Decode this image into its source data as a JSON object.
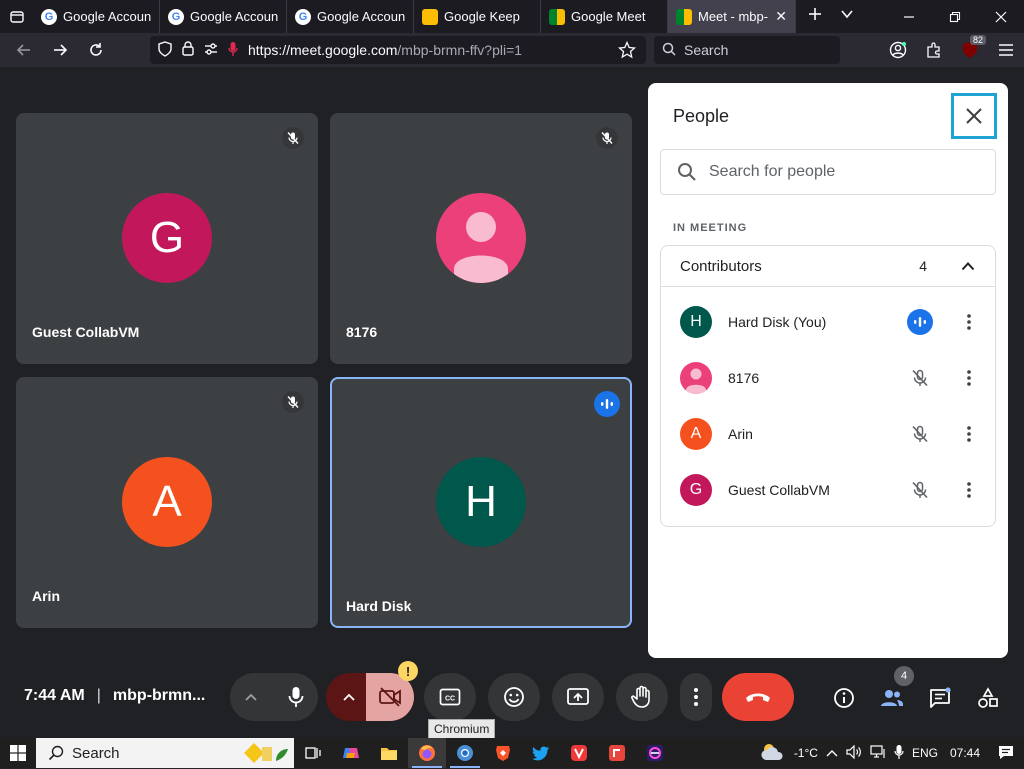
{
  "browser": {
    "tabs": [
      {
        "title": "Google Account",
        "favicon": "google-icon"
      },
      {
        "title": "Google Account",
        "favicon": "google-icon"
      },
      {
        "title": "Google Account",
        "favicon": "google-icon"
      },
      {
        "title": "Google Keep",
        "favicon": "keep-icon"
      },
      {
        "title": "Google Meet",
        "favicon": "meet-icon"
      },
      {
        "title": "Meet - mbp-b",
        "favicon": "meet-icon",
        "active": true
      }
    ],
    "url_host": "https://meet.google.com",
    "url_path": "/mbp-brmn-ffv?pli=1",
    "search_placeholder": "Search",
    "extension_badge": "82"
  },
  "tiles": [
    {
      "name": "Guest CollabVM",
      "initial": "G",
      "color": "#c2185b",
      "muted": true
    },
    {
      "name": "8176",
      "initial": "",
      "color": "#ec407a",
      "muted": true
    },
    {
      "name": "Arin",
      "initial": "A",
      "color": "#f4511e",
      "muted": true
    },
    {
      "name": "Hard Disk",
      "initial": "H",
      "color": "#00574b",
      "speaking": true
    }
  ],
  "people_panel": {
    "title": "People",
    "search_placeholder": "Search for people",
    "section_label": "IN MEETING",
    "group_label": "Contributors",
    "group_count": "4",
    "people": [
      {
        "name": "Hard Disk (You)",
        "initial": "H",
        "color": "#00574b",
        "speaking": true
      },
      {
        "name": "8176",
        "initial": "",
        "color": "#ec407a",
        "speaking": false
      },
      {
        "name": "Arin",
        "initial": "A",
        "color": "#f4511e",
        "speaking": false
      },
      {
        "name": "Guest CollabVM",
        "initial": "G",
        "color": "#c2185b",
        "speaking": false
      }
    ]
  },
  "meeting": {
    "time": "7:44 AM",
    "separator": "|",
    "code": "mbp-brmn...",
    "tooltip": "Chromium",
    "people_count": "4"
  },
  "taskbar": {
    "search_label": "Search",
    "weather": "-1°C",
    "language": "ENG",
    "clock": "07:44"
  }
}
